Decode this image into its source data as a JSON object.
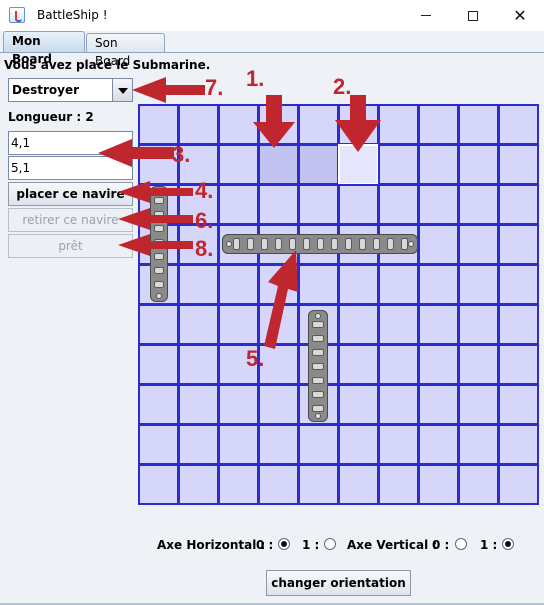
{
  "window": {
    "title": "BattleShip !",
    "icons": [
      "java-app-icon",
      "minimize-icon",
      "maximize-icon",
      "close-icon"
    ],
    "close_glyph": "✕"
  },
  "tabs": [
    {
      "label": "Mon Board",
      "active": true
    },
    {
      "label": "Son Board",
      "active": false
    }
  ],
  "panel": {
    "status_message": "Vous avez placé le Submarine.",
    "ship_select": {
      "selected": "Destroyer"
    },
    "length_label": "Longueur : 2",
    "start_coord": "4,1",
    "end_coord": "5,1",
    "buttons": {
      "place": "placer ce navire",
      "remove": "retirer ce navire",
      "ready": "prêt"
    }
  },
  "board": {
    "columns": 10,
    "rows": 10,
    "hover_cells": [
      [
        3,
        1
      ],
      [
        4,
        1
      ],
      [
        5,
        1
      ]
    ],
    "selected_cell": [
      5,
      1
    ],
    "colors": {
      "water": "#d6d6fb",
      "grid": "#2c2ccf",
      "ship": "#8a8a8a"
    }
  },
  "annotations": {
    "color": "#c0262d",
    "labels": [
      "1.",
      "2.",
      "3.",
      "4.",
      "5.",
      "6.",
      "7.",
      "8."
    ]
  },
  "orientation": {
    "horizontal_label": "Axe Horizontal :",
    "vertical_label": "Axe Vertical :",
    "zero_label": "0 :",
    "one_label": "1 :",
    "horizontal_selected": 0,
    "vertical_selected": 1,
    "change_button": "changer orientation"
  }
}
